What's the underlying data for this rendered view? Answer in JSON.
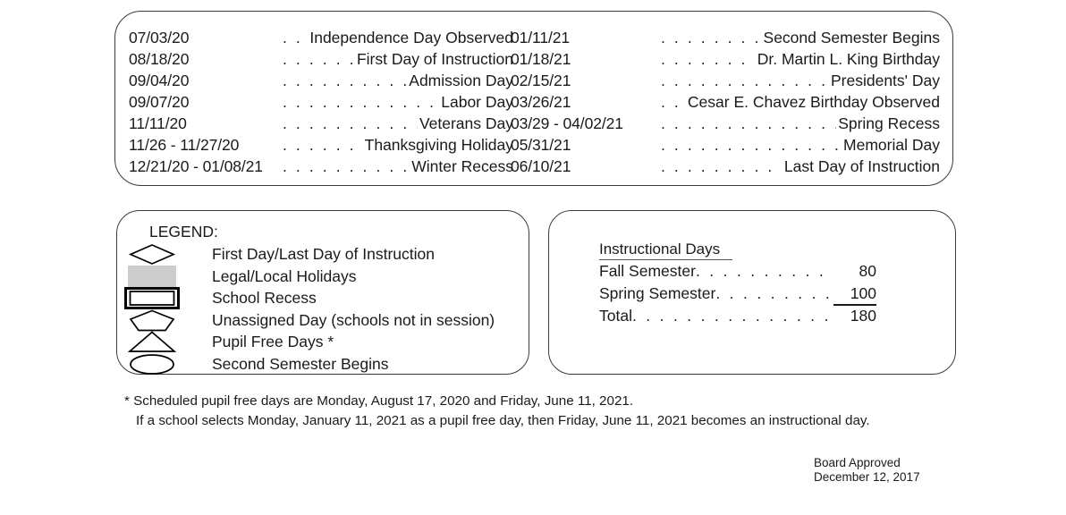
{
  "holidays": {
    "left_column": [
      {
        "date": "07/03/20",
        "label": "Independence Day Observed"
      },
      {
        "date": "08/18/20",
        "label": "First Day of Instruction"
      },
      {
        "date": "09/04/20",
        "label": "Admission Day"
      },
      {
        "date": "09/07/20",
        "label": "Labor Day"
      },
      {
        "date": "11/11/20",
        "label": "Veterans Day"
      },
      {
        "date": "11/26 - 11/27/20",
        "label": "Thanksgiving Holiday"
      },
      {
        "date": "12/21/20 - 01/08/21",
        "label": "Winter Recess"
      }
    ],
    "right_column": [
      {
        "date": "01/11/21",
        "label": "Second Semester Begins"
      },
      {
        "date": "01/18/21",
        "label": "Dr. Martin L. King Birthday"
      },
      {
        "date": "02/15/21",
        "label": "Presidents' Day"
      },
      {
        "date": "03/26/21",
        "label": "Cesar E. Chavez Birthday Observed"
      },
      {
        "date": "03/29 - 04/02/21",
        "label": "Spring Recess"
      },
      {
        "date": "05/31/21",
        "label": "Memorial Day"
      },
      {
        "date": "06/10/21",
        "label": "Last Day of Instruction"
      }
    ]
  },
  "legend": {
    "title": "LEGEND:",
    "items": [
      {
        "icon": "diamond-icon",
        "label": "First Day/Last Day of Instruction"
      },
      {
        "icon": "gray-filled-rectangle-icon",
        "label": "Legal/Local Holidays"
      },
      {
        "icon": "double-border-rectangle-icon",
        "label": "School Recess"
      },
      {
        "icon": "pentagon-icon",
        "label": "Unassigned Day (schools not in session)"
      },
      {
        "icon": "triangle-icon",
        "label": "Pupil Free Days *"
      },
      {
        "icon": "ellipse-icon",
        "label": "Second Semester Begins"
      }
    ],
    "holiday_fill_color": "#CCCCCC",
    "outline_color": "#000000"
  },
  "instructional_days": {
    "heading": "Instructional Days",
    "rows": [
      {
        "label": "Fall Semester",
        "value": "80",
        "ruled": false
      },
      {
        "label": "Spring Semester",
        "value": "100",
        "ruled": true
      },
      {
        "label": "Total",
        "value": "180",
        "ruled": false
      }
    ]
  },
  "footnotes": {
    "line1": "* Scheduled pupil free days are Monday, August 17, 2020 and Friday, June 11, 2021.",
    "line2": "If a school selects Monday, January 11, 2021 as a pupil free day, then Friday, June 11, 2021 becomes an instructional day."
  },
  "approval": {
    "line1": "Board Approved",
    "line2": "December 12, 2017"
  }
}
